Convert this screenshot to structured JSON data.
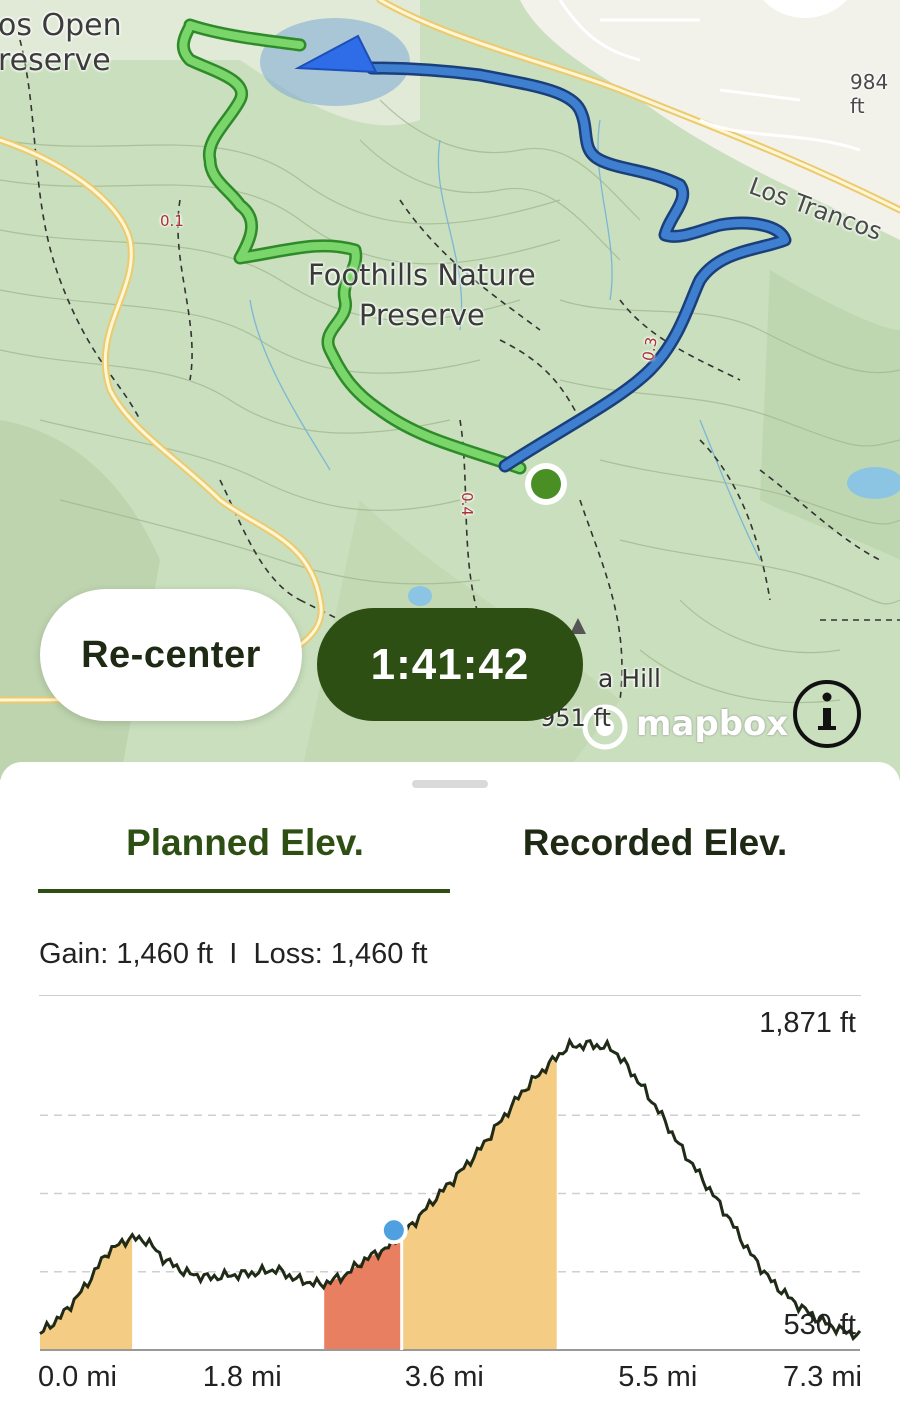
{
  "map": {
    "labels": {
      "preserve_open_line1": "os Open",
      "preserve_open_line2": "reserve",
      "foothills_line1": "Foothills Nature",
      "foothills_line2": "Preserve",
      "elevation_984": "984 ft",
      "road_los_trancos": "Los Trancos",
      "hill_name": "a Hill",
      "hill_elev": "951 ft",
      "trail_01": "0.1",
      "trail_03": "0.3",
      "trail_04": "0.4"
    },
    "attribution": "mapbox",
    "colors": {
      "planned_trail": "#4bb84a",
      "recorded_trail": "#2f6db5",
      "road": "#f5d98a",
      "position_dot": "#4a8f23"
    }
  },
  "controls": {
    "recenter_label": "Re-center",
    "timer": "1:41:42",
    "info_icon": "info-icon"
  },
  "sheet": {
    "tabs": [
      {
        "label": "Planned Elev.",
        "active": true
      },
      {
        "label": "Recorded Elev.",
        "active": false
      }
    ],
    "stats": {
      "gain": "Gain: 1,460 ft",
      "separator": "I",
      "loss": "Loss: 1,460 ft"
    }
  },
  "chart_data": {
    "type": "area",
    "y_max_label": "1,871 ft",
    "y_min_label": "530 ft",
    "ylim": [
      530,
      1871
    ],
    "xlim": [
      0,
      7.3
    ],
    "x_tick_labels": [
      "0.0 mi",
      "1.8 mi",
      "3.6 mi",
      "5.5 mi",
      "7.3 mi"
    ],
    "x_ticks": [
      0.0,
      1.8,
      3.6,
      5.5,
      7.3
    ],
    "grid": "dashed horizontal",
    "profile": {
      "x": [
        0,
        0.2,
        0.4,
        0.6,
        0.8,
        0.95,
        1.1,
        1.3,
        1.5,
        1.7,
        1.9,
        2.1,
        2.3,
        2.5,
        2.7,
        2.9,
        3.1,
        3.3,
        3.5,
        3.7,
        3.9,
        4.1,
        4.3,
        4.5,
        4.7,
        4.9,
        5.1,
        5.3,
        5.5,
        5.7,
        5.9,
        6.1,
        6.3,
        6.5,
        6.7,
        6.9,
        7.1,
        7.3
      ],
      "y": [
        600,
        680,
        800,
        950,
        1010,
        1000,
        920,
        860,
        840,
        850,
        860,
        875,
        830,
        810,
        845,
        920,
        970,
        1060,
        1170,
        1270,
        1380,
        1510,
        1640,
        1740,
        1830,
        1840,
        1820,
        1700,
        1560,
        1400,
        1260,
        1120,
        960,
        830,
        740,
        670,
        620,
        590
      ]
    },
    "climb_segments": [
      [
        0,
        0.82
      ],
      [
        2.53,
        3.22
      ],
      [
        3.22,
        4.6
      ]
    ],
    "current_segment": [
      2.53,
      3.22
    ],
    "current_position": {
      "x": 3.15,
      "y": 1043
    },
    "colors": {
      "line": "#1f2a17",
      "climb_fill": "#f4cc83",
      "current_fill": "#e87f60",
      "marker": "#4fa0e0"
    }
  }
}
